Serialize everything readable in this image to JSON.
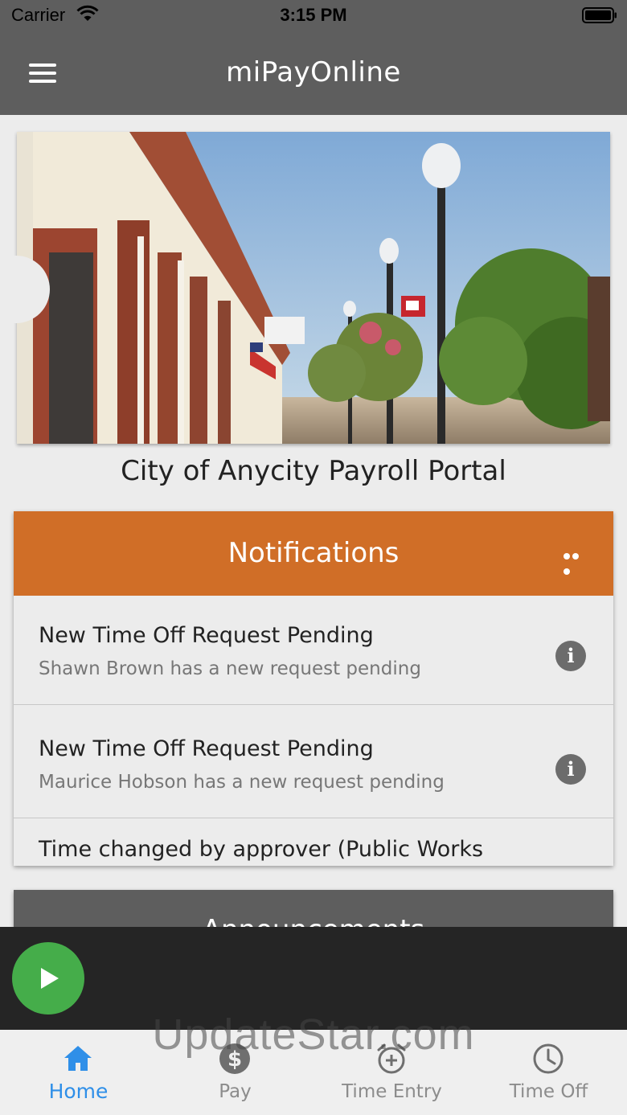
{
  "status_bar": {
    "carrier": "Carrier",
    "time": "3:15 PM"
  },
  "nav": {
    "title": "miPayOnline",
    "menu_icon": "hamburger-menu-icon"
  },
  "portal": {
    "title": "City of Anycity Payroll Portal"
  },
  "notifications": {
    "header": "Notifications",
    "more_icon": "more-dots-icon",
    "items": [
      {
        "title": "New Time Off Request Pending",
        "subtitle": "Shawn Brown has a new request pending"
      },
      {
        "title": "New Time Off Request Pending",
        "subtitle": "Maurice Hobson has a new request pending"
      },
      {
        "title": "Time changed by approver (Public Works"
      }
    ]
  },
  "announcements": {
    "header": "Announcements"
  },
  "tabs": [
    {
      "label": "Home",
      "icon": "home-icon"
    },
    {
      "label": "Pay",
      "icon": "dollar-icon"
    },
    {
      "label": "Time Entry",
      "icon": "alarm-plus-icon"
    },
    {
      "label": "Time Off",
      "icon": "clock-icon"
    }
  ],
  "watermark": "UpdateStar.com",
  "colors": {
    "header_gray": "#5e5e5e",
    "notification_orange": "#d06e27",
    "active_tab_blue": "#2f8fe8",
    "play_green": "#45ad4a"
  }
}
